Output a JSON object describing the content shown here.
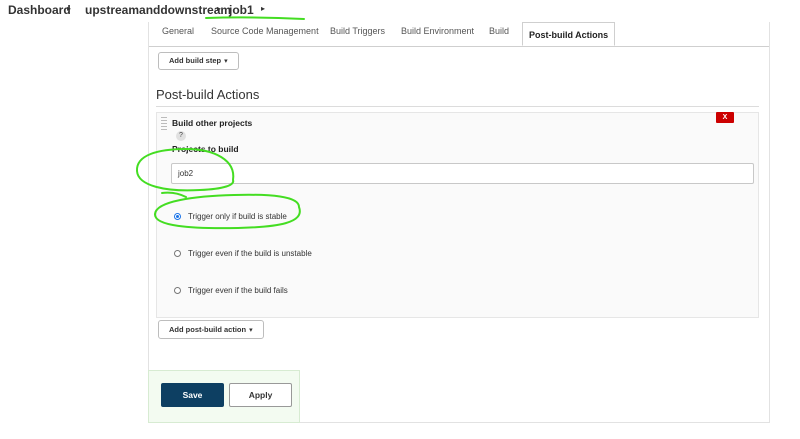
{
  "breadcrumb": {
    "items": [
      "Dashboard",
      "upstreamanddownstream",
      "job1"
    ],
    "separator": "▸"
  },
  "tabs": [
    "General",
    "Source Code Management",
    "Build Triggers",
    "Build Environment",
    "Build",
    "Post-build Actions"
  ],
  "active_tab": "Post-build Actions",
  "add_build_step_label": "Add build step",
  "section_title": "Post-build Actions",
  "action": {
    "title": "Build other projects",
    "help": "?",
    "delete_label": "X",
    "projects_label": "Projects to build",
    "projects_value": "job2",
    "options": [
      {
        "label": "Trigger only if build is stable",
        "checked": true
      },
      {
        "label": "Trigger even if the build is unstable",
        "checked": false
      },
      {
        "label": "Trigger even if the build fails",
        "checked": false
      }
    ]
  },
  "add_post_build_label": "Add post-build action",
  "save_label": "Save",
  "apply_label": "Apply",
  "colors": {
    "annotation": "#44dd22",
    "save_bg": "#0d3f62",
    "delete_bg": "#cc0000",
    "radio_selected": "#1a73e8"
  }
}
